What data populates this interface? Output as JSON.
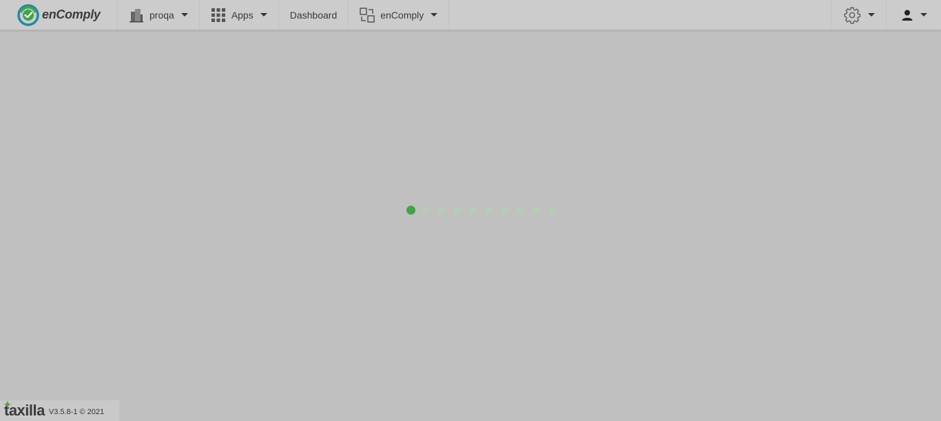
{
  "brand": {
    "name": "enComply"
  },
  "nav": {
    "org_label": "proqa",
    "apps_label": "Apps",
    "dashboard_label": "Dashboard",
    "module_label": "enComply"
  },
  "loader": {
    "dots": 10,
    "active_index": 0
  },
  "footer": {
    "logo_text": "taxilla",
    "version": "V3.5.8-1 © 2021"
  },
  "colors": {
    "accent": "#3fa548",
    "background": "#c0c0c0",
    "topbar": "#cccccc"
  }
}
